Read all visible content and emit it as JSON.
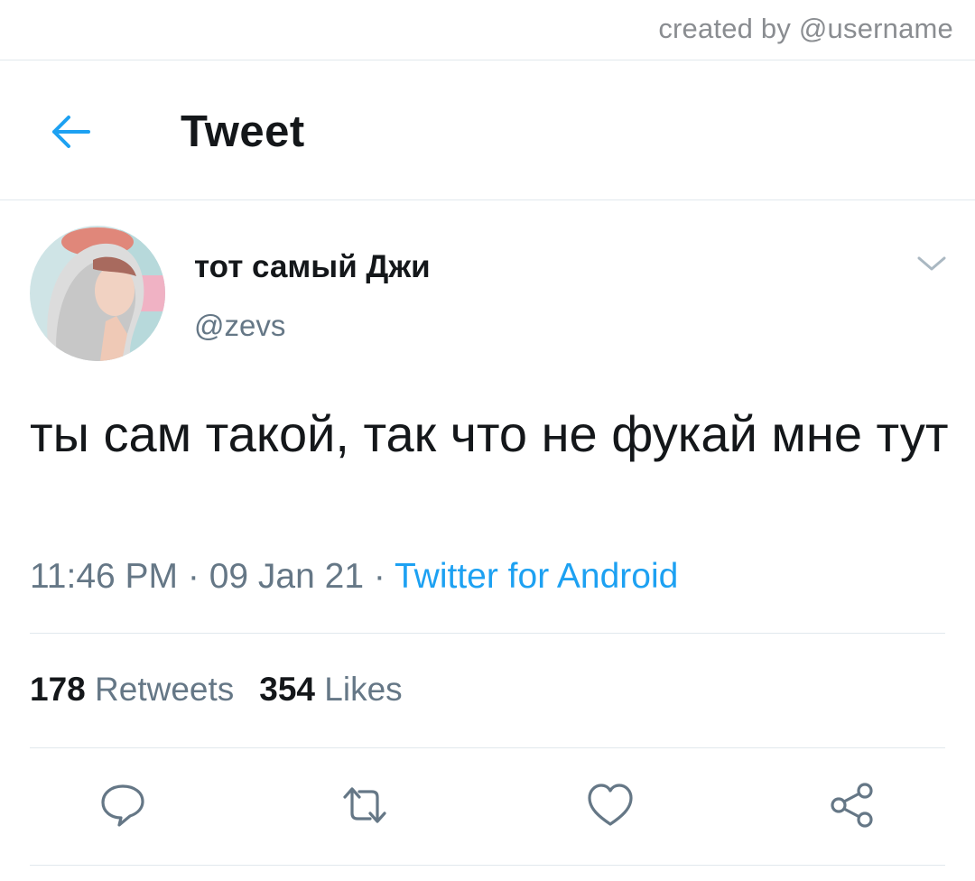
{
  "credit": "created by @username",
  "header": {
    "back_icon": "arrow-left-icon",
    "title": "Tweet"
  },
  "tweet": {
    "display_name": "тот самый Джи",
    "handle": "@zevs",
    "text": "ты сам такой, так что не фукай мне тут",
    "time": "11:46 PM",
    "date": "09 Jan 21",
    "separator": " · ",
    "source": "Twitter for Android",
    "retweets_count": "178",
    "retweets_label": "Retweets",
    "likes_count": "354",
    "likes_label": "Likes"
  },
  "actions": [
    "reply-icon",
    "retweet-icon",
    "like-icon",
    "share-icon"
  ],
  "colors": {
    "accent": "#1da1f2",
    "text": "#14171a",
    "secondary": "#657786",
    "divider": "#e1e8ed"
  }
}
